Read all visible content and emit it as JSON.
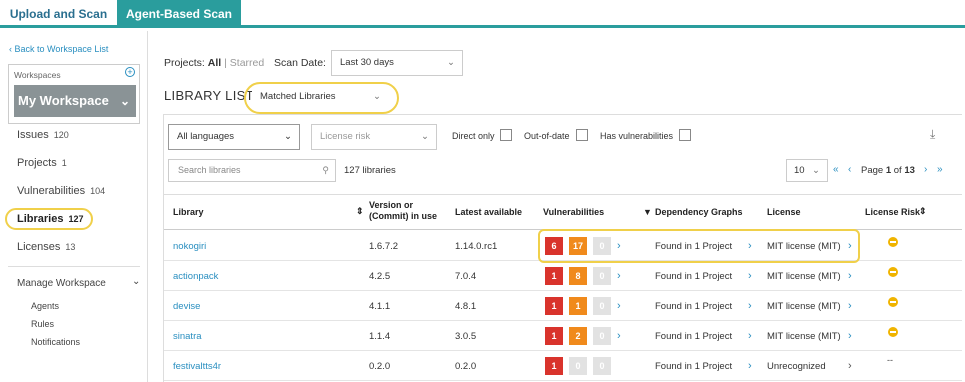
{
  "tabs": [
    {
      "label": "Upload and Scan"
    },
    {
      "label": "Agent-Based Scan"
    }
  ],
  "sidebar": {
    "back_link": "Back to Workspace List",
    "workspaces_label": "Workspaces",
    "workspace_name": "My Workspace",
    "nav": [
      {
        "label": "Issues",
        "count": "120"
      },
      {
        "label": "Projects",
        "count": "1"
      },
      {
        "label": "Vulnerabilities",
        "count": "104"
      },
      {
        "label": "Libraries",
        "count": "127"
      },
      {
        "label": "Licenses",
        "count": "13"
      }
    ],
    "manage_label": "Manage Workspace",
    "manage_items": [
      "Agents",
      "Rules",
      "Notifications"
    ]
  },
  "filters": {
    "projects_label": "Projects:",
    "projects_all": "All",
    "projects_starred": "| Starred",
    "scan_date_label": "Scan Date:",
    "scan_date_value": "Last 30 days",
    "list_title": "LIBRARY LIST",
    "list_mode": "Matched Libraries",
    "languages": "All languages",
    "license_risk_placeholder": "License risk",
    "direct_only": "Direct only",
    "out_of_date": "Out-of-date",
    "has_vulns": "Has vulnerabilities",
    "search_placeholder": "Search libraries",
    "library_count": "127 libraries",
    "page_size": "10",
    "page_label": "Page",
    "page_current": "1",
    "page_of": "of",
    "page_total": "13"
  },
  "table": {
    "headers": {
      "library": "Library",
      "version": "Version or (Commit) in use",
      "latest": "Latest available",
      "vulns": "Vulnerabilities",
      "graphs": "Dependency Graphs",
      "license": "License",
      "risk": "License Risk"
    },
    "rows": [
      {
        "name": "nokogiri",
        "version": "1.6.7.2",
        "latest": "1.14.0.rc1",
        "v": [
          "6",
          "17",
          "0"
        ],
        "graph": "Found in 1 Project",
        "license": "MIT license (MIT)",
        "risk": "medium"
      },
      {
        "name": "actionpack",
        "version": "4.2.5",
        "latest": "7.0.4",
        "v": [
          "1",
          "8",
          "0"
        ],
        "graph": "Found in 1 Project",
        "license": "MIT license (MIT)",
        "risk": "medium"
      },
      {
        "name": "devise",
        "version": "4.1.1",
        "latest": "4.8.1",
        "v": [
          "1",
          "1",
          "0"
        ],
        "graph": "Found in 1 Project",
        "license": "MIT license (MIT)",
        "risk": "medium"
      },
      {
        "name": "sinatra",
        "version": "1.1.4",
        "latest": "3.0.5",
        "v": [
          "1",
          "2",
          "0"
        ],
        "graph": "Found in 1 Project",
        "license": "MIT license (MIT)",
        "risk": "medium"
      },
      {
        "name": "festivaltts4r",
        "version": "0.2.0",
        "latest": "0.2.0",
        "v": [
          "1",
          "0",
          "0"
        ],
        "graph": "Found in 1 Project",
        "license": "Unrecognized",
        "risk": "--"
      }
    ]
  },
  "colors": {
    "accent": "#2a9d9d",
    "link": "#2a8fc0",
    "critical": "#d9332c",
    "high": "#f08a1c",
    "highlight": "#f0d04a"
  }
}
